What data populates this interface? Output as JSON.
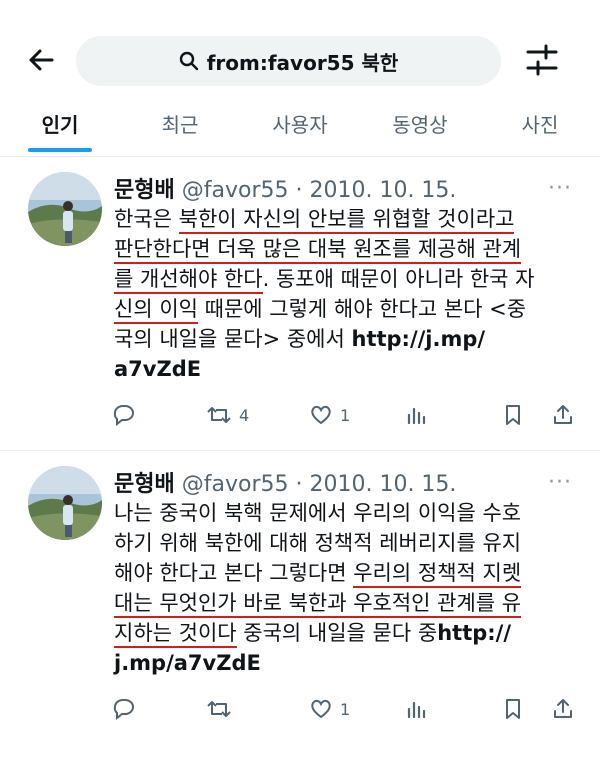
{
  "search": {
    "query": "from:favor55 북한"
  },
  "tabs": [
    {
      "label": "인기"
    },
    {
      "label": "최근"
    },
    {
      "label": "사용자"
    },
    {
      "label": "동영상"
    },
    {
      "label": "사진"
    }
  ],
  "posts": [
    {
      "author": "문형배",
      "handle": "@favor55",
      "date": "2010. 10. 15.",
      "lines": [
        [
          "한국은 ",
          "북한이 자신의 안보를 위협할 것이라고"
        ],
        [
          "판단한다면 더욱 많은 대북 원조를 제공해 관계"
        ],
        [
          "를 개선해야 한다",
          ". 동포애 때문이 아니라 한국 자"
        ],
        [
          "신의 이익",
          " 때문에 그렇게 해야 한다고 본다 <중"
        ],
        [
          "국의 내일을 묻다> 중에서 ",
          "http://j.mp/"
        ],
        [
          "a7vZdE"
        ]
      ],
      "retweets": "4",
      "likes": "1"
    },
    {
      "author": "문형배",
      "handle": "@favor55",
      "date": "2010. 10. 15.",
      "lines": [
        [
          "나는 중국이 북핵 문제에서 우리의 이익을 수호"
        ],
        [
          "하기 위해 북한에 대해 정책적 레버리지를 유지"
        ],
        [
          "해야 한다고 본다 그렇다면 ",
          "우리의 정책적 지렛"
        ],
        [
          "대는 무엇인가 바로 북한과 우호적인 관계를 유"
        ],
        [
          "지하는 것이다",
          " 중국의 내일을 묻다 중",
          "http://"
        ],
        [
          "j.mp/a7vZdE"
        ]
      ],
      "retweets": "",
      "likes": "1"
    }
  ],
  "colors": {
    "accent": "#1d9bf0",
    "underline": "#cc1f1f",
    "secondary": "#536471"
  }
}
